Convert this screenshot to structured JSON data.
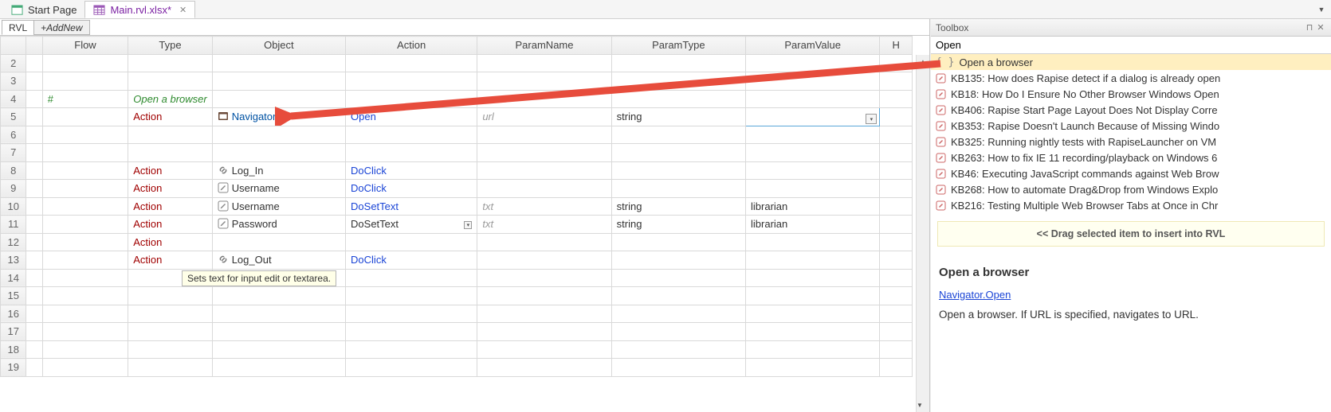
{
  "tabs": {
    "start": "Start Page",
    "main": "Main.rvl.xlsx*"
  },
  "subtabs": {
    "rvl": "RVL",
    "add": "+AddNew"
  },
  "grid": {
    "headers": {
      "flow": "Flow",
      "type": "Type",
      "object": "Object",
      "action": "Action",
      "pname": "ParamName",
      "ptype": "ParamType",
      "pvalue": "ParamValue",
      "h": "H"
    },
    "rownums": [
      "2",
      "3",
      "4",
      "5",
      "6",
      "7",
      "8",
      "9",
      "10",
      "11",
      "12",
      "13",
      "14",
      "15",
      "16",
      "17",
      "18",
      "19"
    ],
    "r4": {
      "flow": "#",
      "type": "Open a browser"
    },
    "r5": {
      "type": "Action",
      "object": "Navigator",
      "action": "Open",
      "pname": "url",
      "ptype": "string"
    },
    "r8": {
      "type": "Action",
      "object": "Log_In",
      "action": "DoClick"
    },
    "r9": {
      "type": "Action",
      "object": "Username",
      "action": "DoClick"
    },
    "r10": {
      "type": "Action",
      "object": "Username",
      "action": "DoSetText",
      "pname": "txt",
      "ptype": "string",
      "pvalue": "librarian"
    },
    "r11": {
      "type": "Action",
      "object": "Password",
      "action": "DoSetText",
      "pname": "txt",
      "ptype": "string",
      "pvalue": "librarian"
    },
    "r12": {
      "type": "Action"
    },
    "r13": {
      "type": "Action",
      "object": "Log_Out",
      "action": "DoClick"
    },
    "tooltip": "Sets text for input edit or textarea."
  },
  "toolbox": {
    "title": "Toolbox",
    "search": "Open",
    "items": [
      "Open a browser",
      "KB135: How does Rapise detect if a dialog is already open",
      "KB18: How Do I Ensure No Other Browser Windows Open",
      "KB406: Rapise Start Page Layout Does Not Display Corre",
      "KB353: Rapise Doesn't Launch Because of Missing Windo",
      "KB325: Running nightly tests with RapiseLauncher on VM",
      "KB263: How to fix IE 11 recording/playback on Windows 6",
      "KB46: Executing JavaScript commands against Web Brow",
      "KB268: How to automate Drag&Drop from Windows Explo",
      "KB216: Testing Multiple Web Browser Tabs at Once in Chr"
    ],
    "hint": "<< Drag selected item to insert into RVL",
    "doc_title": "Open a browser",
    "doc_link": "Navigator.Open",
    "doc_body": "Open a browser. If URL is specified, navigates to URL."
  }
}
